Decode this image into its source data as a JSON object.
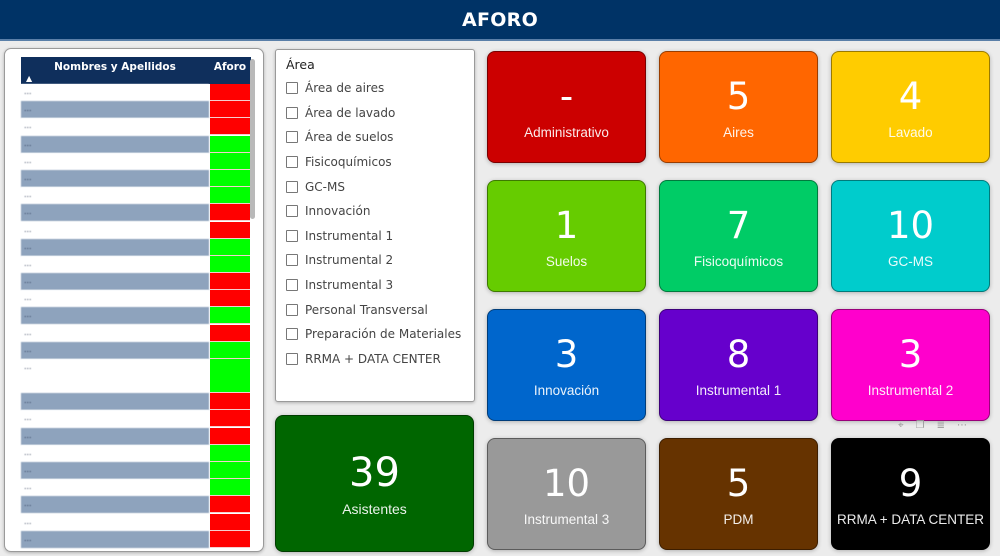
{
  "header": {
    "title": "AFORO"
  },
  "table": {
    "columns": {
      "name": "Nombres y Apellidos",
      "aforo": "Aforo"
    },
    "sort_icon": "sort-indicator-icon",
    "status_colors": {
      "red": "#ff0000",
      "green": "#00ff00"
    },
    "rows": [
      {
        "name": "…",
        "status": "red"
      },
      {
        "name": "…",
        "status": "red"
      },
      {
        "name": "…",
        "status": "red"
      },
      {
        "name": "…",
        "status": "green"
      },
      {
        "name": "…",
        "status": "green"
      },
      {
        "name": "…",
        "status": "green"
      },
      {
        "name": "…",
        "status": "green"
      },
      {
        "name": "…",
        "status": "red"
      },
      {
        "name": "…",
        "status": "red"
      },
      {
        "name": "…",
        "status": "green"
      },
      {
        "name": "…",
        "status": "green"
      },
      {
        "name": "…",
        "status": "red"
      },
      {
        "name": "…",
        "status": "red"
      },
      {
        "name": "…",
        "status": "green"
      },
      {
        "name": "…",
        "status": "red"
      },
      {
        "name": "…",
        "status": "green"
      },
      {
        "name": "…",
        "status": "green",
        "tall": true
      },
      {
        "name": "…",
        "status": "red"
      },
      {
        "name": "…",
        "status": "red"
      },
      {
        "name": "…",
        "status": "red"
      },
      {
        "name": "…",
        "status": "green"
      },
      {
        "name": "…",
        "status": "green"
      },
      {
        "name": "…",
        "status": "green"
      },
      {
        "name": "…",
        "status": "red"
      },
      {
        "name": "…",
        "status": "red"
      },
      {
        "name": "…",
        "status": "red"
      }
    ]
  },
  "slicer": {
    "title": "Área",
    "items": [
      "Área de aires",
      "Área de lavado",
      "Área de suelos",
      "Fisicoquímicos",
      "GC-MS",
      "Innovación",
      "Instrumental 1",
      "Instrumental 2",
      "Instrumental 3",
      "Personal Transversal",
      "Preparación de Materiales",
      "RRMA + DATA CENTER"
    ]
  },
  "total": {
    "value": "39",
    "label": "Asistentes",
    "color": "#006600"
  },
  "cards": [
    {
      "value": "-",
      "label": "Administrativo",
      "color": "#cc0000"
    },
    {
      "value": "5",
      "label": "Aires",
      "color": "#ff6600"
    },
    {
      "value": "4",
      "label": "Lavado",
      "color": "#ffcc00"
    },
    {
      "value": "1",
      "label": "Suelos",
      "color": "#66cc00"
    },
    {
      "value": "7",
      "label": "Fisicoquímicos",
      "color": "#00cc66"
    },
    {
      "value": "10",
      "label": "GC-MS",
      "color": "#00cccc"
    },
    {
      "value": "3",
      "label": "Innovación",
      "color": "#0066cc"
    },
    {
      "value": "8",
      "label": "Instrumental 1",
      "color": "#6600cc"
    },
    {
      "value": "3",
      "label": "Instrumental 2",
      "color": "#ff00cc"
    },
    {
      "value": "10",
      "label": "Instrumental 3",
      "color": "#999999"
    },
    {
      "value": "5",
      "label": "PDM",
      "color": "#663300"
    },
    {
      "value": "9",
      "label": "RRMA + DATA CENTER",
      "color": "#000000"
    }
  ],
  "visual_tools": [
    {
      "icon": "pin-icon",
      "glyph": "⌖"
    },
    {
      "icon": "copy-icon",
      "glyph": "❐"
    },
    {
      "icon": "filter-icon",
      "glyph": "≣"
    },
    {
      "icon": "more-options-icon",
      "glyph": "⋯"
    }
  ]
}
